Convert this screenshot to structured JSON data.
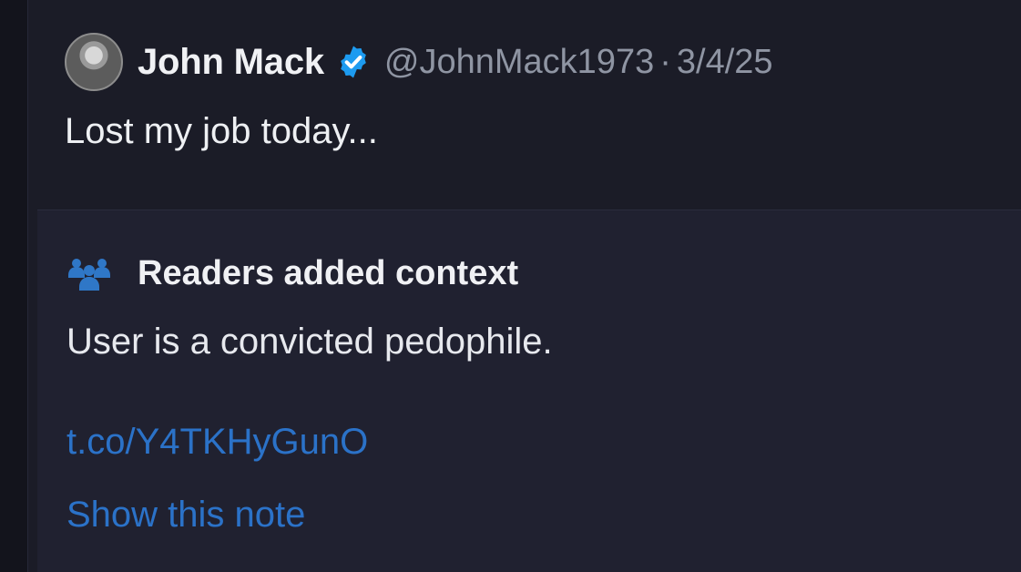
{
  "tweet": {
    "display_name": "John Mack",
    "handle": "@JohnMack1973",
    "separator": "·",
    "date": "3/4/25",
    "text": "Lost my job today...",
    "verified_icon": "verified-badge-icon",
    "avatar_icon": "avatar"
  },
  "community_note": {
    "icon": "people-icon",
    "title": "Readers added context",
    "body": "User is a convicted pedophile.",
    "link": "t.co/Y4TKHyGunO",
    "show_note_label": "Show this note"
  },
  "colors": {
    "background": "#1b1c27",
    "note_background": "#202130",
    "verified_blue": "#1d9bf0",
    "link_blue": "#2b72c8",
    "muted_text": "#8f95a3",
    "people_icon": "#2f77c7"
  }
}
